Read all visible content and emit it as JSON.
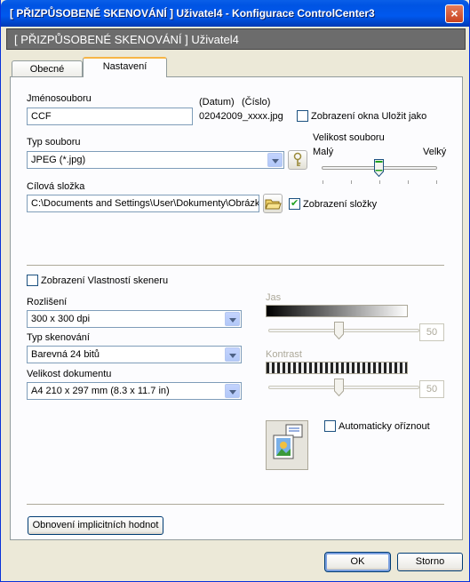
{
  "window": {
    "title": "[ PŘIZPŮSOBENÉ SKENOVÁNÍ ]  Uživatel4 - Konfigurace ControlCenter3",
    "close_glyph": "×"
  },
  "header": {
    "text": "[ PŘIZPŮSOBENÉ SKENOVÁNÍ ]  Uživatel4"
  },
  "tabs": [
    {
      "label": "Obecné",
      "active": false
    },
    {
      "label": "Nastavení",
      "active": true
    }
  ],
  "file": {
    "name_label": "Jménosouboru",
    "name_value": "CCF",
    "datum_label": "(Datum)",
    "cislo_label": "(Číslo)",
    "preview_name": "02042009_xxxx.jpg",
    "save_as_label": "Zobrazení okna Uložit jako",
    "save_as_checked": false
  },
  "filetype": {
    "label": "Typ souboru",
    "value": "JPEG (*.jpg)"
  },
  "filesize": {
    "label": "Velikost souboru",
    "small": "Malý",
    "large": "Velký",
    "level": 0.5
  },
  "folder": {
    "label": "Cílová složka",
    "value": "C:\\Documents and Settings\\User\\Dokumenty\\Obrázk",
    "show_label": "Zobrazení složky",
    "show_checked": true
  },
  "scanner": {
    "properties_label": "Zobrazení Vlastností skeneru",
    "properties_checked": false,
    "resolution_label": "Rozlišení",
    "resolution_value": "300 x 300 dpi",
    "scantype_label": "Typ skenování",
    "scantype_value": "Barevná 24 bitů",
    "docsize_label": "Velikost dokumentu",
    "docsize_value": "A4 210 x 297 mm (8.3 x 11.7 in)",
    "brightness_label": "Jas",
    "brightness_value": "50",
    "contrast_label": "Kontrast",
    "contrast_value": "50",
    "autocrop_label": "Automaticky oříznout",
    "autocrop_checked": false
  },
  "buttons": {
    "restore_defaults": "Obnovení implicitních hodnot",
    "ok": "OK",
    "cancel": "Storno"
  },
  "colors": {
    "title_blue": "#0054e3",
    "banner_gray": "#6c6c6c",
    "tab_highlight": "#f7b646",
    "window_bg": "#ece9d8"
  }
}
